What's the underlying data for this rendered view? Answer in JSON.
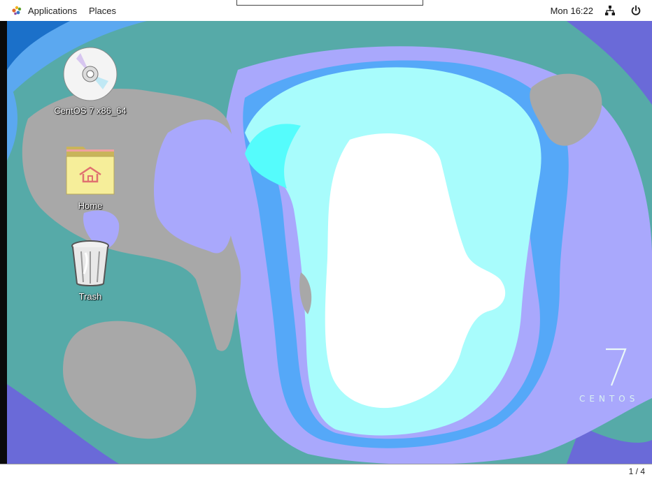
{
  "topbar": {
    "applications_label": "Applications",
    "places_label": "Places",
    "clock": "Mon 16:22",
    "network_icon": "network-wired-icon",
    "power_icon": "power-icon"
  },
  "desktop": {
    "icons": [
      {
        "label": "CentOS 7 x86_64",
        "icon": "cdrom-icon"
      },
      {
        "label": "Home",
        "icon": "home-folder-icon"
      },
      {
        "label": "Trash",
        "icon": "trash-icon"
      }
    ],
    "brand": {
      "numeral": "7",
      "text": "CENTOS"
    }
  },
  "bottombar": {
    "workspace": "1 / 4"
  },
  "colors": {
    "teal": "#56aaa8",
    "grey": "#a8a8a8",
    "lavender": "#a9a8fc",
    "blue": "#55a8f8",
    "cyan": "#a8fcfc",
    "bright_cyan": "#55fcfc",
    "white": "#ffffff"
  }
}
